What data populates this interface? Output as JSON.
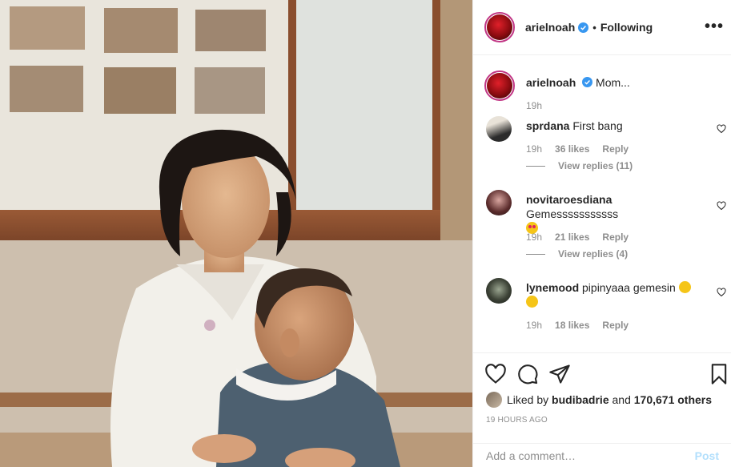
{
  "header": {
    "username": "arielnoah",
    "separator": "•",
    "follow_status": "Following",
    "more_label": "•••"
  },
  "caption": {
    "username": "arielnoah",
    "text": "Mom...",
    "time": "19h"
  },
  "comments": [
    {
      "username": "sprdana",
      "text": "First bang",
      "time": "19h",
      "likes": "36 likes",
      "reply": "Reply",
      "view_replies": "View replies (11)"
    },
    {
      "username": "novitaroesdiana",
      "text": "Gemesssssssssss",
      "time": "19h",
      "likes": "21 likes",
      "reply": "Reply",
      "view_replies": "View replies (4)"
    },
    {
      "username": "lynemood",
      "text": "pipinyaaa gemesin",
      "time": "19h",
      "likes": "18 likes",
      "reply": "Reply"
    }
  ],
  "likes": {
    "prefix": "Liked by",
    "user": "budibadrie",
    "and": "and",
    "others": "170,671 others"
  },
  "timestamp": "19 HOURS AGO",
  "add_comment": {
    "placeholder": "Add a comment…",
    "post_label": "Post"
  },
  "icons": [
    "verified-icon",
    "heart-icon",
    "comment-icon",
    "share-icon",
    "save-icon",
    "more-icon"
  ],
  "colors": {
    "verified": "#3897f0",
    "link_disabled": "#b2dffc",
    "muted": "#8e8e8e",
    "text": "#262626"
  }
}
